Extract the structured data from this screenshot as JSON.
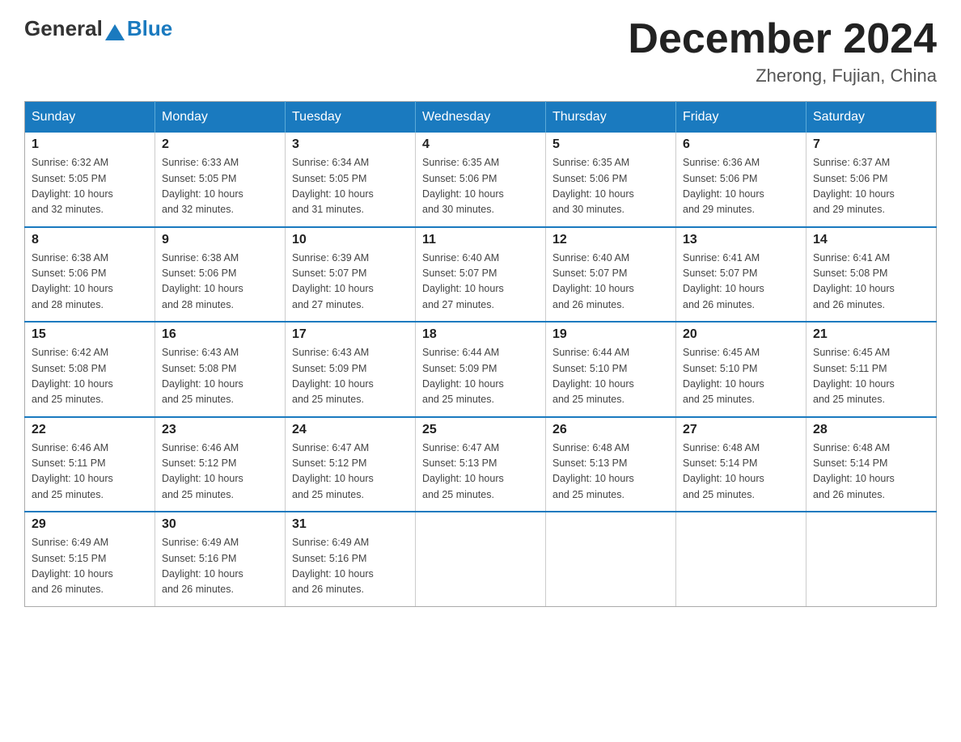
{
  "logo": {
    "general": "General",
    "blue": "Blue"
  },
  "title": "December 2024",
  "location": "Zherong, Fujian, China",
  "days_of_week": [
    "Sunday",
    "Monday",
    "Tuesday",
    "Wednesday",
    "Thursday",
    "Friday",
    "Saturday"
  ],
  "weeks": [
    [
      {
        "day": "1",
        "info": "Sunrise: 6:32 AM\nSunset: 5:05 PM\nDaylight: 10 hours\nand 32 minutes."
      },
      {
        "day": "2",
        "info": "Sunrise: 6:33 AM\nSunset: 5:05 PM\nDaylight: 10 hours\nand 32 minutes."
      },
      {
        "day": "3",
        "info": "Sunrise: 6:34 AM\nSunset: 5:05 PM\nDaylight: 10 hours\nand 31 minutes."
      },
      {
        "day": "4",
        "info": "Sunrise: 6:35 AM\nSunset: 5:06 PM\nDaylight: 10 hours\nand 30 minutes."
      },
      {
        "day": "5",
        "info": "Sunrise: 6:35 AM\nSunset: 5:06 PM\nDaylight: 10 hours\nand 30 minutes."
      },
      {
        "day": "6",
        "info": "Sunrise: 6:36 AM\nSunset: 5:06 PM\nDaylight: 10 hours\nand 29 minutes."
      },
      {
        "day": "7",
        "info": "Sunrise: 6:37 AM\nSunset: 5:06 PM\nDaylight: 10 hours\nand 29 minutes."
      }
    ],
    [
      {
        "day": "8",
        "info": "Sunrise: 6:38 AM\nSunset: 5:06 PM\nDaylight: 10 hours\nand 28 minutes."
      },
      {
        "day": "9",
        "info": "Sunrise: 6:38 AM\nSunset: 5:06 PM\nDaylight: 10 hours\nand 28 minutes."
      },
      {
        "day": "10",
        "info": "Sunrise: 6:39 AM\nSunset: 5:07 PM\nDaylight: 10 hours\nand 27 minutes."
      },
      {
        "day": "11",
        "info": "Sunrise: 6:40 AM\nSunset: 5:07 PM\nDaylight: 10 hours\nand 27 minutes."
      },
      {
        "day": "12",
        "info": "Sunrise: 6:40 AM\nSunset: 5:07 PM\nDaylight: 10 hours\nand 26 minutes."
      },
      {
        "day": "13",
        "info": "Sunrise: 6:41 AM\nSunset: 5:07 PM\nDaylight: 10 hours\nand 26 minutes."
      },
      {
        "day": "14",
        "info": "Sunrise: 6:41 AM\nSunset: 5:08 PM\nDaylight: 10 hours\nand 26 minutes."
      }
    ],
    [
      {
        "day": "15",
        "info": "Sunrise: 6:42 AM\nSunset: 5:08 PM\nDaylight: 10 hours\nand 25 minutes."
      },
      {
        "day": "16",
        "info": "Sunrise: 6:43 AM\nSunset: 5:08 PM\nDaylight: 10 hours\nand 25 minutes."
      },
      {
        "day": "17",
        "info": "Sunrise: 6:43 AM\nSunset: 5:09 PM\nDaylight: 10 hours\nand 25 minutes."
      },
      {
        "day": "18",
        "info": "Sunrise: 6:44 AM\nSunset: 5:09 PM\nDaylight: 10 hours\nand 25 minutes."
      },
      {
        "day": "19",
        "info": "Sunrise: 6:44 AM\nSunset: 5:10 PM\nDaylight: 10 hours\nand 25 minutes."
      },
      {
        "day": "20",
        "info": "Sunrise: 6:45 AM\nSunset: 5:10 PM\nDaylight: 10 hours\nand 25 minutes."
      },
      {
        "day": "21",
        "info": "Sunrise: 6:45 AM\nSunset: 5:11 PM\nDaylight: 10 hours\nand 25 minutes."
      }
    ],
    [
      {
        "day": "22",
        "info": "Sunrise: 6:46 AM\nSunset: 5:11 PM\nDaylight: 10 hours\nand 25 minutes."
      },
      {
        "day": "23",
        "info": "Sunrise: 6:46 AM\nSunset: 5:12 PM\nDaylight: 10 hours\nand 25 minutes."
      },
      {
        "day": "24",
        "info": "Sunrise: 6:47 AM\nSunset: 5:12 PM\nDaylight: 10 hours\nand 25 minutes."
      },
      {
        "day": "25",
        "info": "Sunrise: 6:47 AM\nSunset: 5:13 PM\nDaylight: 10 hours\nand 25 minutes."
      },
      {
        "day": "26",
        "info": "Sunrise: 6:48 AM\nSunset: 5:13 PM\nDaylight: 10 hours\nand 25 minutes."
      },
      {
        "day": "27",
        "info": "Sunrise: 6:48 AM\nSunset: 5:14 PM\nDaylight: 10 hours\nand 25 minutes."
      },
      {
        "day": "28",
        "info": "Sunrise: 6:48 AM\nSunset: 5:14 PM\nDaylight: 10 hours\nand 26 minutes."
      }
    ],
    [
      {
        "day": "29",
        "info": "Sunrise: 6:49 AM\nSunset: 5:15 PM\nDaylight: 10 hours\nand 26 minutes."
      },
      {
        "day": "30",
        "info": "Sunrise: 6:49 AM\nSunset: 5:16 PM\nDaylight: 10 hours\nand 26 minutes."
      },
      {
        "day": "31",
        "info": "Sunrise: 6:49 AM\nSunset: 5:16 PM\nDaylight: 10 hours\nand 26 minutes."
      },
      null,
      null,
      null,
      null
    ]
  ]
}
